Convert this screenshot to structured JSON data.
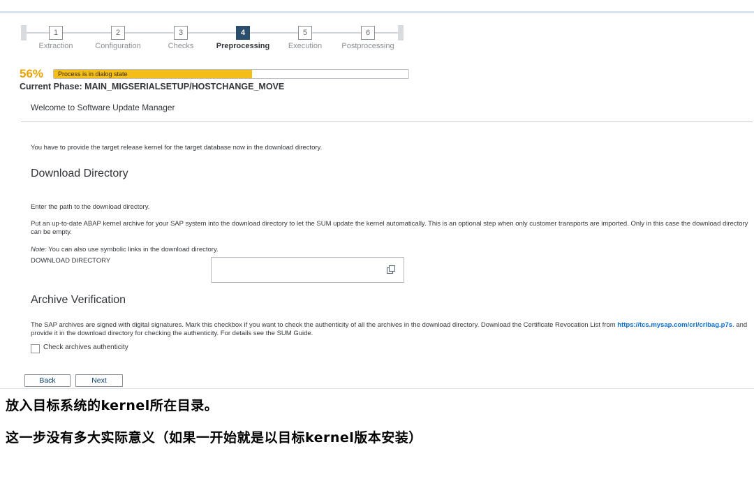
{
  "wizard": {
    "steps": [
      {
        "number": "1",
        "label": "Extraction"
      },
      {
        "number": "2",
        "label": "Configuration"
      },
      {
        "number": "3",
        "label": "Checks"
      },
      {
        "number": "4",
        "label": "Preprocessing"
      },
      {
        "number": "5",
        "label": "Execution"
      },
      {
        "number": "6",
        "label": "Postprocessing"
      }
    ],
    "active_step": 4
  },
  "progress": {
    "percent_label": "56%",
    "value": 0.56,
    "status_text": "Process is in dialog state",
    "fill_color": "#f3be17"
  },
  "phase": "Current Phase: MAIN_MIGSERIALSETUP/HOSTCHANGE_MOVE",
  "welcome": "Welcome to Software Update Manager",
  "intro": "You have to provide the target release kernel for the target database now in the download directory.",
  "download_section": {
    "title": "Download Directory",
    "instruction": "Enter the path to the download directory.",
    "description": "Put an up-to-date ABAP kernel archive for your SAP system into the download directory to let the SUM update the kernel automatically. This is an optional step when only customer transports are imported. Only in this case the download directory can be empty.",
    "note_label": "Note:",
    "note_text": " You can also use symbolic links in the download directory.",
    "field_label": "DOWNLOAD DIRECTORY",
    "field_value": "",
    "field_icon": "copy-icon"
  },
  "archive_section": {
    "title": "Archive Verification",
    "text_before_link": "The SAP archives are signed with digital signatures. Mark this checkbox if you want to check the authenticity of all the archives in the download directory. Download the Certificate Revocation List from",
    "link": "https://tcs.mysap.com/crl/crlbag.p7s",
    "text_after_link": ". and provide it in the download directory for checking the authenticity. For details see the SUM Guide.",
    "checkbox_label": "Check archives authenticity",
    "checkbox_checked": false
  },
  "buttons": {
    "back": "Back",
    "next": "Next"
  },
  "annotations": {
    "line1": "放入目标系统的kernel所在目录。",
    "line2": "这一步没有多大实际意义（如果一开始就是以目标kernel版本安装）"
  },
  "colors": {
    "active_step": "#2c4e6c",
    "percent": "#e9a300",
    "link": "#0a6ed1"
  }
}
